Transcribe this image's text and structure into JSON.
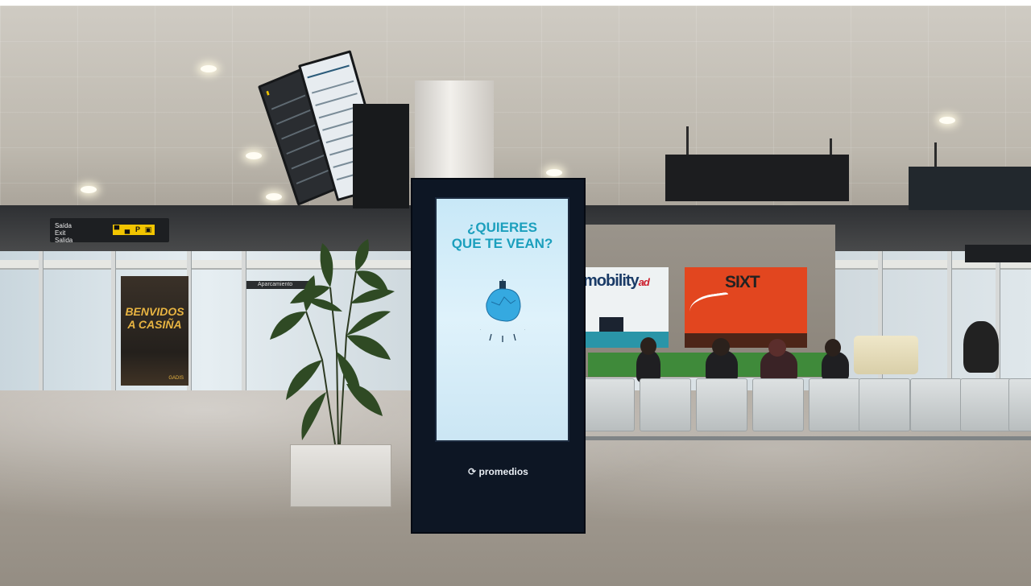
{
  "photo": {
    "scene": "airport terminal arrivals hall",
    "totem_ad": {
      "headline_line1": "¿QUIERES",
      "headline_line2": "QUE TE VEAN?",
      "brand": "promedios",
      "screen_color": "#d8f0fa",
      "headline_color": "#1b9fbd"
    },
    "wayfinding_sign": {
      "text_line1": "Saída",
      "text_line2": "Exit",
      "text_line3": "Salida",
      "icons": [
        "bus-icon",
        "car-icon",
        "parking-icon",
        "taxi-icon"
      ]
    },
    "poster": {
      "text_line1": "BENVIDOS",
      "text_line2": "A CASIÑA",
      "logo": "GADIS"
    },
    "parking_sign": "Aparcamiento",
    "rental_desks": [
      {
        "brand": "mobility",
        "suffix": "ad"
      },
      {
        "brand": "SIXT"
      }
    ]
  }
}
